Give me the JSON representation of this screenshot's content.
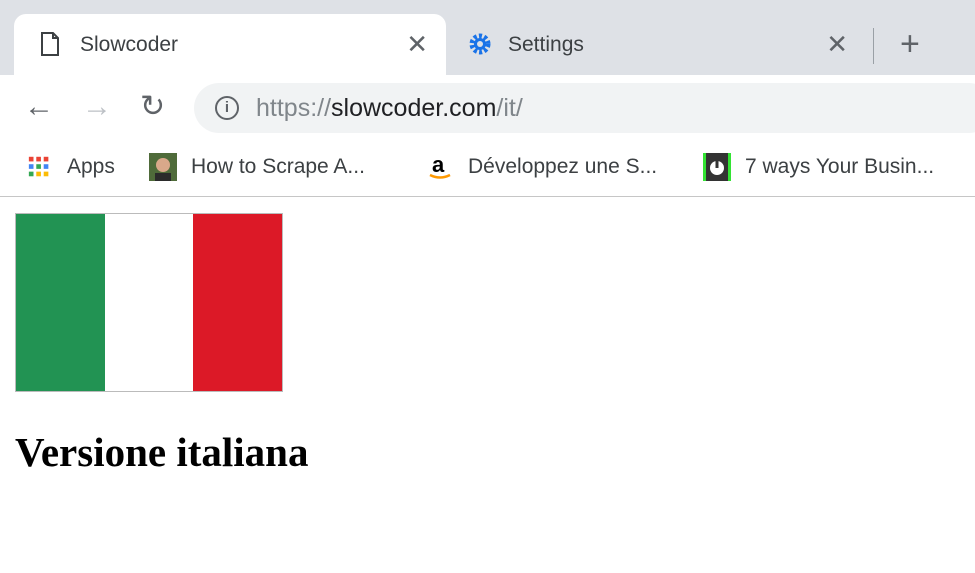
{
  "tabs": [
    {
      "label": "Slowcoder",
      "icon": "page-icon",
      "active": true
    },
    {
      "label": "Settings",
      "icon": "gear-icon",
      "active": false
    }
  ],
  "address_bar": {
    "scheme": "https://",
    "host": "slowcoder.com",
    "path": "/it/"
  },
  "bookmarks": [
    {
      "label": "Apps",
      "icon": "apps-grid-icon"
    },
    {
      "label": "How to Scrape A...",
      "icon": "avatar-icon"
    },
    {
      "label": "Développez une S...",
      "icon": "amazon-icon"
    },
    {
      "label": "7 ways Your Busin...",
      "icon": "power-icon"
    }
  ],
  "page": {
    "flag_colors": [
      "#229353",
      "#ffffff",
      "#dc1927"
    ],
    "heading": "Versione italiana"
  }
}
